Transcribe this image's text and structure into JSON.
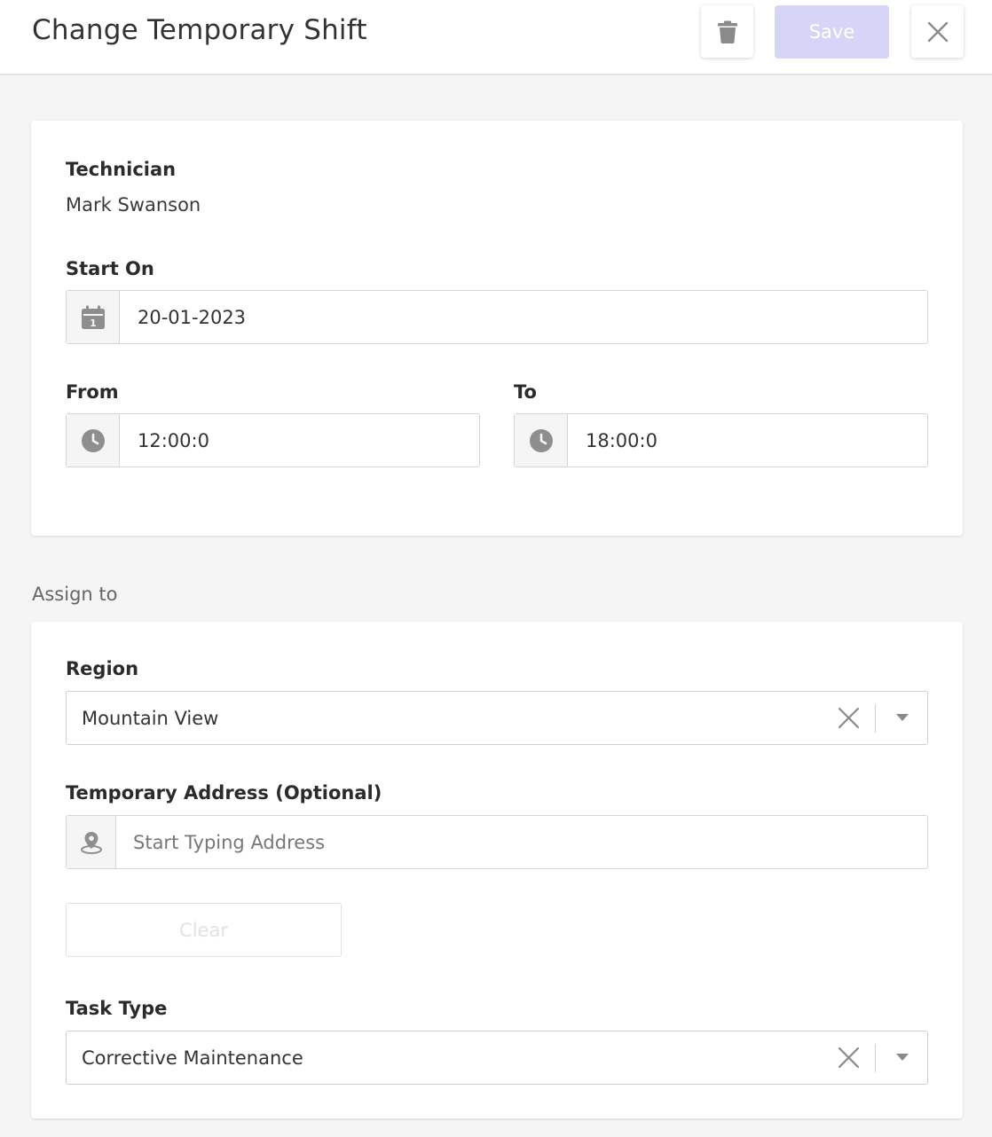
{
  "header": {
    "title": "Change Temporary Shift",
    "save_label": "Save"
  },
  "shift": {
    "technician_label": "Technician",
    "technician_name": "Mark Swanson",
    "start_on_label": "Start On",
    "start_on_value": "20-01-2023",
    "from_label": "From",
    "from_value": "12:00:0",
    "to_label": "To",
    "to_value": "18:00:0"
  },
  "assign": {
    "section_title": "Assign to",
    "region_label": "Region",
    "region_value": "Mountain View",
    "address_label": "Temporary Address (Optional)",
    "address_placeholder": "Start Typing Address",
    "clear_label": "Clear",
    "task_type_label": "Task Type",
    "task_type_value": "Corrective Maintenance"
  },
  "icons": {
    "delete": "trash-icon",
    "close": "close-icon",
    "calendar": "calendar-icon",
    "clock": "clock-icon",
    "location": "location-pin-icon",
    "clear_selection": "clear-x-icon",
    "dropdown": "caret-down-icon"
  },
  "colors": {
    "save_disabled": "#d6d5f7",
    "page_background": "#f5f5f5",
    "icon_gray": "#8e8e8e"
  }
}
